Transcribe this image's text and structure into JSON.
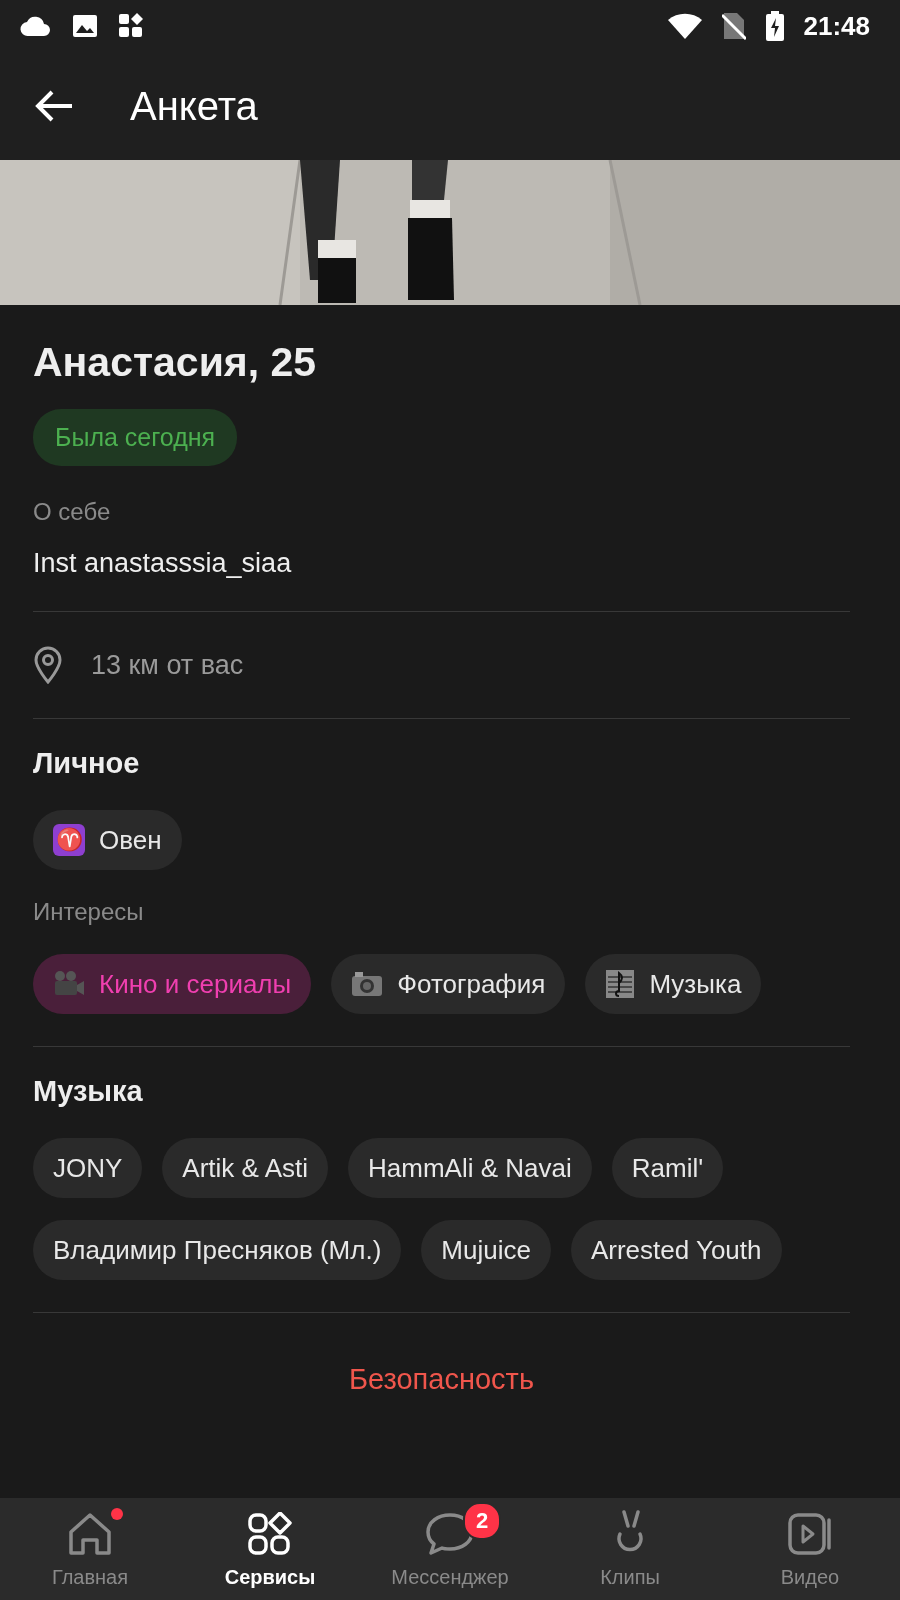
{
  "status_bar": {
    "time": "21:48"
  },
  "app_bar": {
    "title": "Анкета"
  },
  "profile": {
    "name": "Анастасия, 25",
    "status": "Была сегодня",
    "about_label": "О себе",
    "about": "Inst anastasssia_siaa",
    "distance": "13 км от вас"
  },
  "personal": {
    "title": "Личное",
    "chips": [
      {
        "icon": "♈",
        "label": "Овен"
      }
    ]
  },
  "interests": {
    "title": "Интересы",
    "chips": [
      {
        "kind": "movie",
        "label": "Кино и сериалы",
        "selected": true
      },
      {
        "label": "Фотография",
        "selected": false
      },
      {
        "kind": "music",
        "label": "Музыка",
        "selected": false
      }
    ]
  },
  "music": {
    "title": "Музыка",
    "chips": [
      "JONY",
      "Artik & Asti",
      "HammAli & Navai",
      "Ramil'",
      "Владимир Пресняков (Мл.)",
      "Mujuice",
      "Arrested Youth"
    ]
  },
  "safety_link": "Безопасность",
  "bottom_nav": [
    {
      "kind": "home",
      "label": "Главная",
      "selected": false,
      "dot": true
    },
    {
      "kind": "services",
      "label": "Сервисы",
      "selected": true,
      "dot": false
    },
    {
      "kind": "messenger",
      "label": "Мессенджер",
      "selected": false,
      "dot": false,
      "badge": "2"
    },
    {
      "kind": "clips",
      "label": "Клипы",
      "selected": false,
      "dot": false
    },
    {
      "kind": "video",
      "label": "Видео",
      "selected": false,
      "dot": false
    }
  ]
}
